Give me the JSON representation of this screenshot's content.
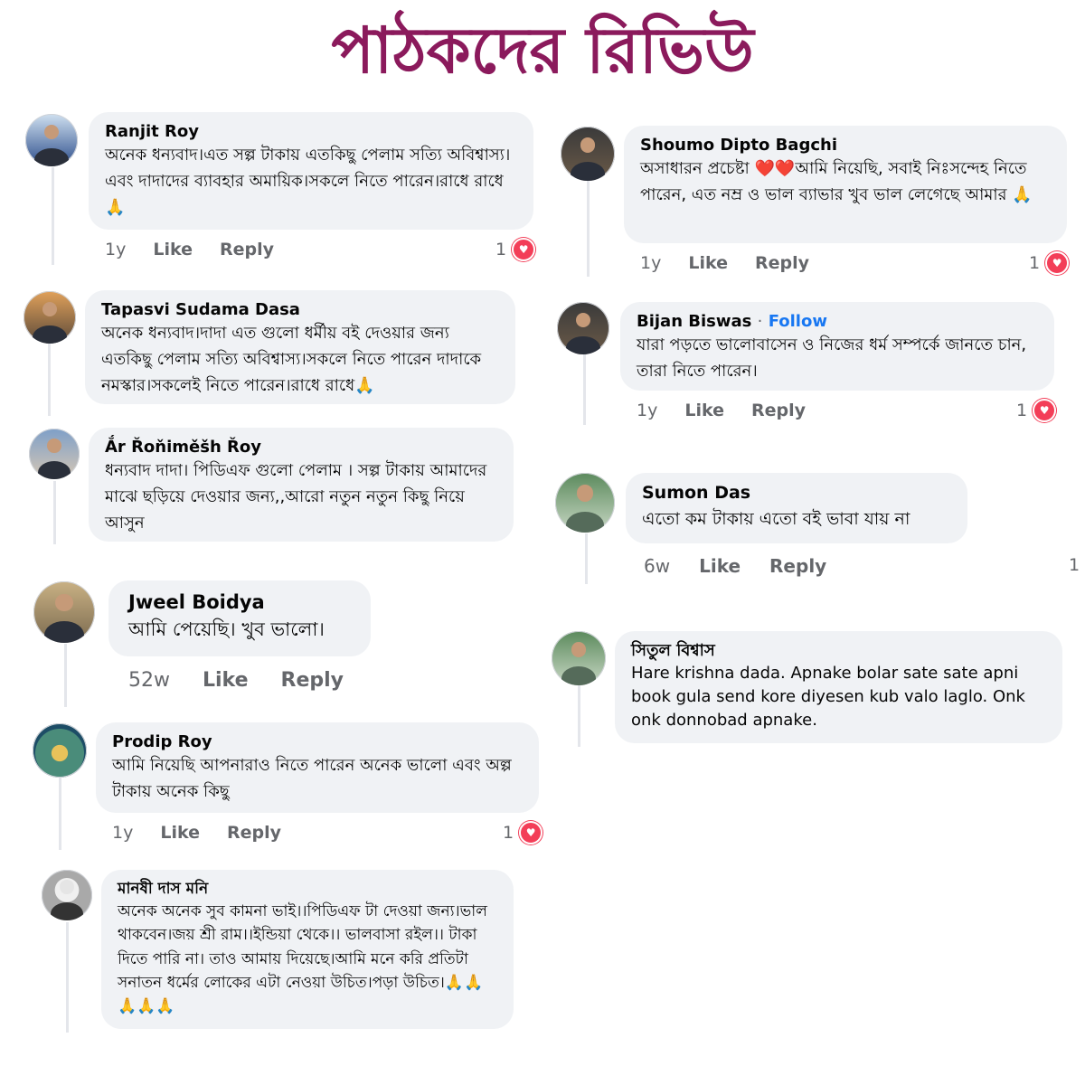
{
  "page_title": "পাঠকদের রিভিউ",
  "comments": [
    {
      "author": "Ranjit Roy",
      "text": "অনেক ধন্যবাদ।এত সল্প টাকায় এতকিছু পেলাম সত্যি অবিশ্বাস্য।এবং দাদাদের ব্যাবহার অমায়িক।সকলে নিতে পারেন।রাধে রাধে🙏",
      "time": "1y",
      "like": "Like",
      "reply": "Reply",
      "reactions": "1"
    },
    {
      "author": "Tapasvi Sudama Dasa",
      "text": "অনেক ধন্যবাদ।দাদা এত গুলো ধর্মীয় বই দেওয়ার জন্য এতকিছু পেলাম সত্যি অবিশ্বাস্য।সকলে নিতে পারেন দাদাকে নমস্কার।সকলেই নিতে পারেন।রাধে রাধে🙏"
    },
    {
      "author": "Ắr Řoňiměšh Řoy",
      "text": "ধন্যবাদ  দাদা। পিডিএফ গুলো পেলাম । সল্প টাকায় আমাদের  মাঝে ছড়িয়ে দেওয়ার  জন্য,,আরো নতুন নতুন কিছু নিয়ে আসুন"
    },
    {
      "author": "Jweel Boidya",
      "text": "আমি পেয়েছি। খুব ভালো।",
      "time": "52w",
      "like": "Like",
      "reply": "Reply"
    },
    {
      "author": "Prodip Roy",
      "text": "আমি নিয়েছি আপনারাও নিতে পারেন অনেক ভালো এবং অল্প টাকায় অনেক কিছু",
      "time": "1y",
      "like": "Like",
      "reply": "Reply",
      "reactions": "1"
    },
    {
      "author": "মানষী দাস মনি",
      "text": "অনেক অনেক সুব কামনা  ভাই।।পিডিএফ টা দেওয়া জন্য।ভাল থাকবেন।জয় শ্রী রাম।।ইন্ডিয়া থেকে।। ভালবাসা রইল।। টাকা দিতে পারি না। তাও আমায় দিয়েছে।আমি মনে করি প্রতিটা সনাতন ধর্মের লোকের এটা নেওয়া উচিত।পড়া উচিত।🙏🙏🙏🙏🙏"
    },
    {
      "author": "Shoumo Dipto Bagchi",
      "text": "অসাধারন প্রচেষ্টা ❤️❤️আমি নিয়েছি, সবাই নিঃসন্দেহ নিতে পারেন, এত নম্র ও ভাল ব্যাভার খুব ভাল লেগেছে আমার 🙏",
      "time": "1y",
      "like": "Like",
      "reply": "Reply",
      "reactions": "1"
    },
    {
      "author": "Bijan Biswas",
      "follow": "Follow",
      "text": "যারা পড়তে ভালোবাসেন ও নিজের ধর্ম সম্পর্কে জানতে চান, তারা নিতে পারেন।",
      "time": "1y",
      "like": "Like",
      "reply": "Reply",
      "reactions": "1"
    },
    {
      "author": "Sumon Das",
      "text": "এতো কম টাকায় এতো বই ভাবা যায় না",
      "time": "6w",
      "like": "Like",
      "reply": "Reply",
      "reactions": "1"
    },
    {
      "author": "সিতুল বিশ্বাস",
      "text": "Hare krishna dada. Apnake bolar sate sate apni book gula send kore diyesen kub valo laglo. Onk onk donnobad apnake."
    }
  ]
}
